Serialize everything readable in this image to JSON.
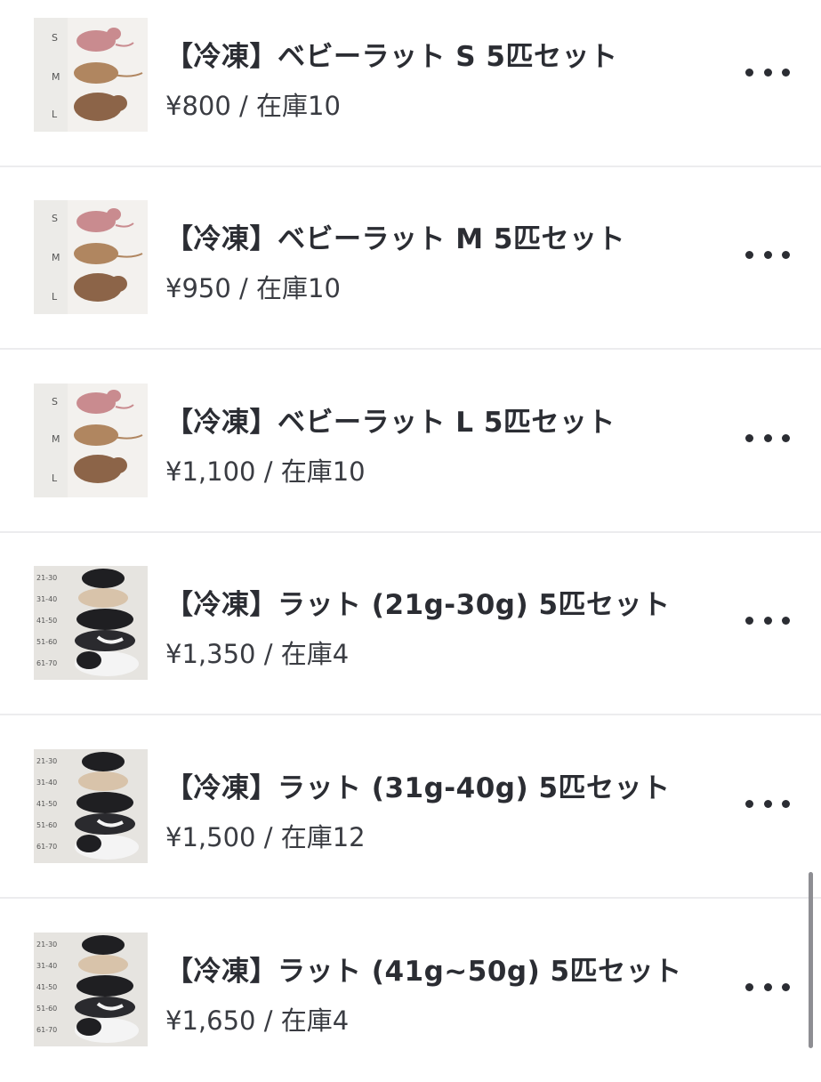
{
  "products": [
    {
      "title": "【冷凍】ベビーラット S 5匹セット",
      "price": "¥800",
      "separator": " / ",
      "stock": "在庫10",
      "image": {
        "kind": "baby-rat",
        "labels": [
          "S",
          "M",
          "L"
        ]
      },
      "more_icon": "ellipsis-icon"
    },
    {
      "title": "【冷凍】ベビーラット M 5匹セット",
      "price": "¥950",
      "separator": " / ",
      "stock": "在庫10",
      "image": {
        "kind": "baby-rat",
        "labels": [
          "S",
          "M",
          "L"
        ]
      },
      "more_icon": "ellipsis-icon"
    },
    {
      "title": "【冷凍】ベビーラット L 5匹セット",
      "price": "¥1,100",
      "separator": " / ",
      "stock": "在庫10",
      "image": {
        "kind": "baby-rat",
        "labels": [
          "S",
          "M",
          "L"
        ]
      },
      "more_icon": "ellipsis-icon"
    },
    {
      "title": "【冷凍】ラット (21g-30g) 5匹セット",
      "price": "¥1,350",
      "separator": " / ",
      "stock": "在庫4",
      "image": {
        "kind": "adult-rat",
        "labels": [
          "21-30",
          "31-40",
          "41-50",
          "51-60",
          "61-70"
        ]
      },
      "more_icon": "ellipsis-icon"
    },
    {
      "title": "【冷凍】ラット (31g-40g) 5匹セット",
      "price": "¥1,500",
      "separator": " / ",
      "stock": "在庫12",
      "image": {
        "kind": "adult-rat",
        "labels": [
          "21-30",
          "31-40",
          "41-50",
          "51-60",
          "61-70"
        ]
      },
      "more_icon": "ellipsis-icon"
    },
    {
      "title": "【冷凍】ラット (41g~50g) 5匹セット",
      "price": "¥1,650",
      "separator": " / ",
      "stock": "在庫4",
      "image": {
        "kind": "adult-rat",
        "labels": [
          "21-30",
          "31-40",
          "41-50",
          "51-60",
          "61-70"
        ]
      },
      "more_icon": "ellipsis-icon"
    }
  ],
  "colors": {
    "text": "#2b2d33",
    "divider": "#ececee",
    "pink_rat": "#c98b8f",
    "tan_rat": "#b08660",
    "brown_rat": "#8c6448",
    "black_rat": "#1f1f22"
  }
}
